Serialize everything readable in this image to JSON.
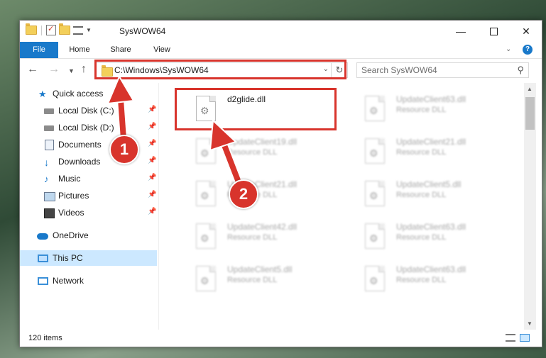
{
  "window": {
    "title": "SysWOW64"
  },
  "ribbon": {
    "tabs": [
      "File",
      "Home",
      "Share",
      "View"
    ]
  },
  "nav": {
    "address": "C:\\Windows\\SysWOW64",
    "search_placeholder": "Search SysWOW64"
  },
  "sidebar": {
    "items": [
      {
        "label": "Quick access",
        "icon": "star-icon"
      },
      {
        "label": "Local Disk (C:)",
        "icon": "disk-icon",
        "pinned": true
      },
      {
        "label": "Local Disk (D:)",
        "icon": "disk-icon",
        "pinned": true
      },
      {
        "label": "Documents",
        "icon": "document-icon",
        "pinned": true
      },
      {
        "label": "Downloads",
        "icon": "download-icon",
        "pinned": true
      },
      {
        "label": "Music",
        "icon": "music-icon",
        "pinned": true
      },
      {
        "label": "Pictures",
        "icon": "picture-icon",
        "pinned": true
      },
      {
        "label": "Videos",
        "icon": "video-icon",
        "pinned": true
      },
      {
        "label": "OneDrive",
        "icon": "cloud-icon"
      },
      {
        "label": "This PC",
        "icon": "computer-icon",
        "selected": true
      },
      {
        "label": "Network",
        "icon": "network-icon"
      }
    ]
  },
  "files": [
    {
      "name": "d2glide.dll",
      "type": ""
    },
    {
      "name": "UpdateClient63.dll",
      "type": "Resource DLL"
    },
    {
      "name": "UpdateClient19.dll",
      "type": "Resource DLL"
    },
    {
      "name": "UpdateClient21.dll",
      "type": "Resource DLL"
    },
    {
      "name": "UpdateClient21.dll",
      "type": "Resource DLL"
    },
    {
      "name": "UpdateClient5.dll",
      "type": "Resource DLL"
    },
    {
      "name": "UpdateClient42.dll",
      "type": "Resource DLL"
    },
    {
      "name": "UpdateClient63.dll",
      "type": "Resource DLL"
    },
    {
      "name": "UpdateClient5.dll",
      "type": "Resource DLL"
    },
    {
      "name": "UpdateClient63.dll",
      "type": "Resource DLL"
    }
  ],
  "status": {
    "item_count": "120 items"
  },
  "callouts": {
    "step1": "1",
    "step2": "2"
  },
  "colors": {
    "accent": "#1979ca",
    "highlight": "#d8342c",
    "selected": "#cce8ff"
  }
}
